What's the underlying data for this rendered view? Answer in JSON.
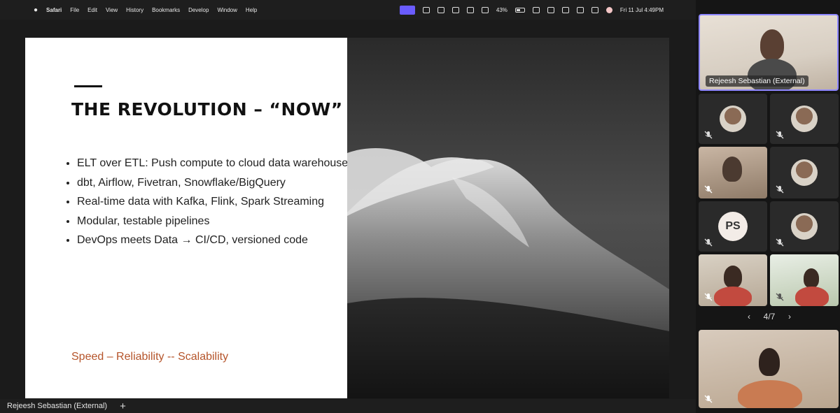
{
  "menubar": {
    "app_name": "Safari",
    "menus": [
      "File",
      "Edit",
      "View",
      "History",
      "Bookmarks",
      "Develop",
      "Window",
      "Help"
    ],
    "battery_percent": "43%",
    "datetime": "Fri 11 Jul  4:49PM"
  },
  "slide": {
    "title": "THE REVOLUTION – “NOW”",
    "bullets": [
      "ELT over ETL: Push compute to cloud data warehouses",
      "dbt, Airflow, Fivetran, Snowflake/BigQuery",
      "Real-time data with Kafka, Flink, Spark Streaming",
      "Modular, testable pipelines",
      "DevOps meets Data → CI/CD, versioned code"
    ],
    "tagline": "Speed – Reliability -- Scalability",
    "tagline_color": "#b5542a"
  },
  "presenter_bar": {
    "name": "Rejeesh Sebastian (External)"
  },
  "participants": {
    "featured_name": "Rejeesh Sebastian (External)",
    "grid_initials": "PS",
    "pager": "4/7",
    "accent_color": "#8e87ff"
  }
}
